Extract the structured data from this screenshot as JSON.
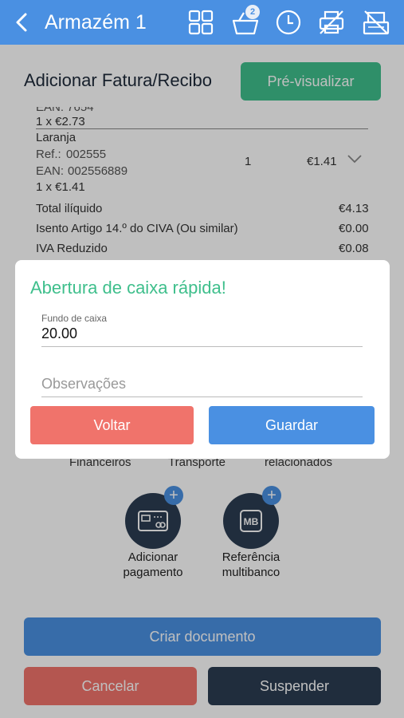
{
  "header": {
    "title": "Armazém 1",
    "cart_count": "2",
    "icons": [
      "chevron-left-icon",
      "grid-icon",
      "basket-icon",
      "clock-icon",
      "printer-off-icon",
      "cash-register-off-icon"
    ]
  },
  "page": {
    "title": "Adicionar Fatura/Recibo",
    "preview_label": "Pré-visualizar"
  },
  "items": {
    "prev_item_cut": "EAN: 7654",
    "prev_item_qty": "1  x  €2.73",
    "item": {
      "name": "Laranja",
      "ref_label": "Ref.:",
      "ref": "002555",
      "ean_label": "EAN:",
      "ean": "002556889",
      "qty_price": "1  x  €1.41",
      "qty": "1",
      "total": "€1.41"
    }
  },
  "totals": [
    {
      "label": "Total ilíquido",
      "value": "€4.13"
    },
    {
      "label": "Isento Artigo 14.º do CIVA (Ou similar)",
      "value": "€0.00"
    },
    {
      "label": "IVA Reduzido",
      "value": "€0.08"
    }
  ],
  "related": {
    "captions": [
      "Financeiros",
      "Transporte",
      "relacionados"
    ]
  },
  "actions": [
    {
      "label_1": "Adicionar",
      "label_2": "pagamento",
      "icon": "card-icon"
    },
    {
      "label_1": "Referência",
      "label_2": "multibanco",
      "icon": "multibanco-icon",
      "icon_text": "MB"
    }
  ],
  "footer": {
    "criar": "Criar documento",
    "cancelar": "Cancelar",
    "suspender": "Suspender"
  },
  "dialog": {
    "title": "Abertura de caixa rápida!",
    "fundo_label": "Fundo de caixa",
    "fundo_value": "20.00",
    "obs_placeholder": "Observações",
    "voltar": "Voltar",
    "guardar": "Guardar"
  }
}
